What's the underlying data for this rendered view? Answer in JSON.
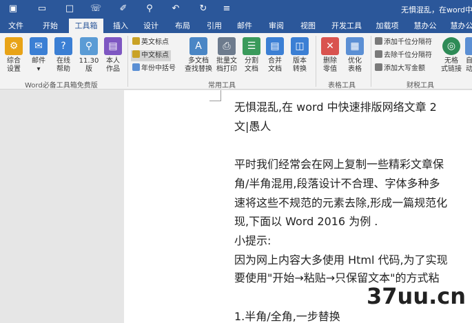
{
  "window": {
    "title": "无惧混乱，在word中快"
  },
  "quick_access": {
    "icons": [
      "save-icon",
      "open-folder-icon",
      "new-document-icon",
      "mail-merge-icon",
      "format-painter-icon",
      "print-preview-icon",
      "undo-icon",
      "redo-icon",
      "customize-dropdown-icon"
    ]
  },
  "tabs": [
    "文件",
    "开始",
    "工具箱",
    "插入",
    "设计",
    "布局",
    "引用",
    "邮件",
    "审阅",
    "视图",
    "开发工具",
    "加载项",
    "慧办公",
    "慧办公"
  ],
  "active_tab": "工具箱",
  "ribbon": {
    "group1": {
      "label": "Word必备工具箱免费版",
      "buttons": [
        {
          "label": "综合\n设置",
          "icon": "settings-icon",
          "color": "#e8a317"
        },
        {
          "label": "邮件\n▾",
          "icon": "mail-icon",
          "color": "#3b7fd4"
        },
        {
          "label": "在线\n帮助",
          "icon": "help-icon",
          "color": "#3b7fd4"
        },
        {
          "label": "11.30\n版",
          "icon": "version-icon",
          "color": "#5a9bd5"
        },
        {
          "label": "本人\n作品",
          "icon": "works-icon",
          "color": "#7e57c2"
        }
      ]
    },
    "group2": {
      "label": "常用工具",
      "small_buttons": [
        "英文标点",
        "中文标点",
        "年份中括号"
      ],
      "buttons": [
        {
          "label": "多文档\n查找替换",
          "icon": "find-replace-icon",
          "color": "#4a86c5"
        },
        {
          "label": "批量文\n档打印",
          "icon": "batch-print-icon",
          "color": "#6d7b8d"
        },
        {
          "label": "分割\n文档",
          "icon": "split-doc-icon",
          "color": "#3a9a5b"
        },
        {
          "label": "合并\n文档",
          "icon": "merge-doc-icon",
          "color": "#3b7fd4"
        },
        {
          "label": "版本\n转换",
          "icon": "convert-icon",
          "color": "#3b7fd4"
        }
      ]
    },
    "group3": {
      "label": "表格工具",
      "buttons": [
        {
          "label": "删除\n零值",
          "icon": "delete-zero-icon",
          "color": "#d9534f"
        },
        {
          "label": "优化\n表格",
          "icon": "optimize-table-icon",
          "color": "#5b8fd4"
        }
      ]
    },
    "group4": {
      "label": "财税工具",
      "small_buttons": [
        "添加千位分隔符",
        "去除千位分隔符",
        "添加大写金额"
      ],
      "buttons": [
        {
          "label": "无格\n式链接",
          "icon": "globe-link-icon",
          "color": "#2e8b57"
        },
        {
          "label": "自\n动",
          "icon": "auto-icon",
          "color": "#5b8fd4"
        }
      ]
    }
  },
  "document": {
    "lines": [
      "无惧混乱,在 word 中快速排版网络文章   2",
      "文|愚人",
      "",
      "平时我们经常会在网上复制一些精彩文章保",
      "角/半角混用,段落设计不合理、字体多种多",
      "速将这些不规范的元素去除,形成一篇规范化",
      "现,下面以 Word 2016 为例  .",
      "小提示:",
      "因为网上内容大多使用  Html  代码,为了实现",
      "要使用\"开始→粘贴→只保留文本\"的方式粘",
      "",
      "1.半角/全角,一步替换"
    ]
  },
  "watermark": "37uu.cn"
}
